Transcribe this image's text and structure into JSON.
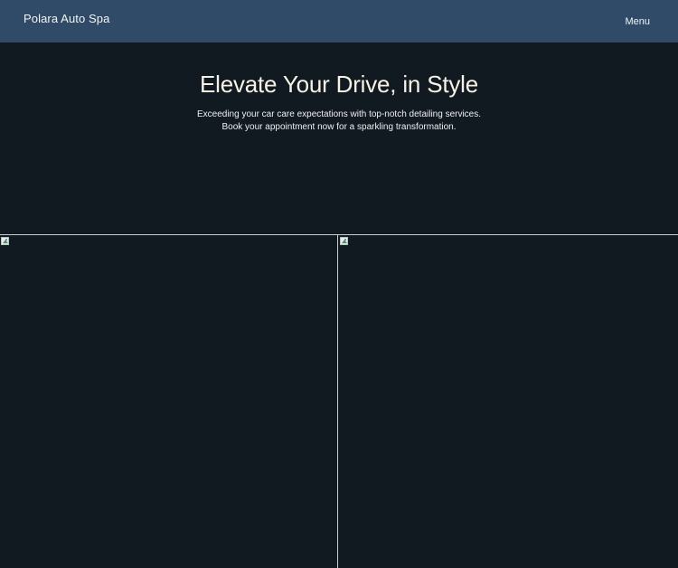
{
  "header": {
    "brand": "Polara Auto Spa",
    "menu_label": "Menu"
  },
  "hero": {
    "title": "Elevate Your Drive, in Style",
    "subtitle_line1": "Exceeding your car care expectations with top-notch detailing services.",
    "subtitle_line2": "Book your appointment now for a sparkling transformation."
  },
  "gallery": {
    "images": [
      {
        "icon": "broken-image-icon"
      },
      {
        "icon": "broken-image-icon"
      }
    ]
  },
  "colors": {
    "header_bg": "#2f4b68",
    "page_bg": "#111921",
    "title_text": "#f7f2e6",
    "body_text": "#eef0f2"
  }
}
